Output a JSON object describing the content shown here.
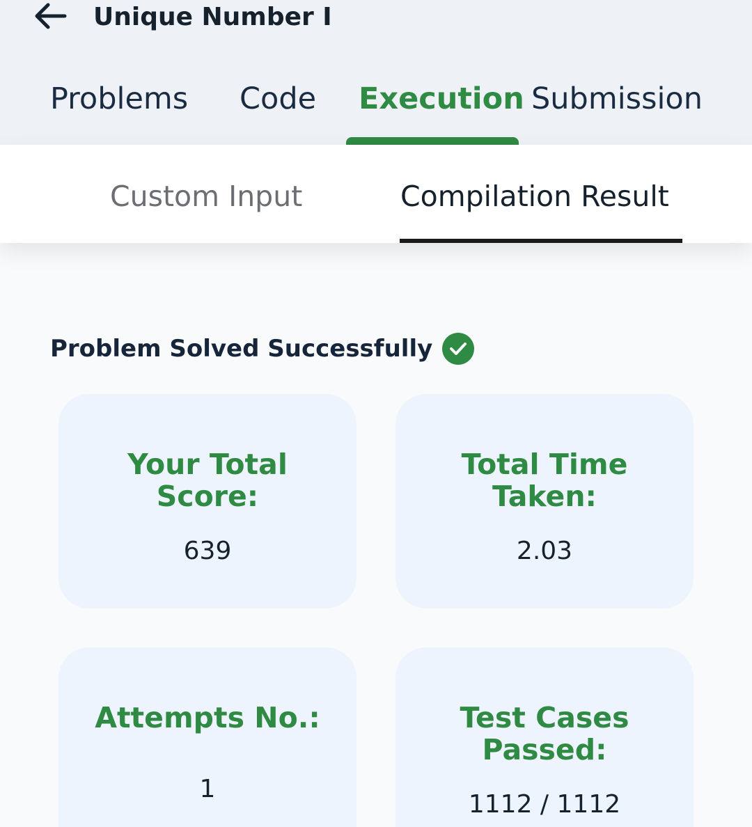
{
  "header": {
    "back_icon": "arrow-left-icon",
    "title": "Unique Number I"
  },
  "tabs": [
    {
      "label": "Problems",
      "active": false
    },
    {
      "label": "Code",
      "active": false
    },
    {
      "label": "Execution",
      "active": true
    },
    {
      "label": "Submission",
      "active": false
    }
  ],
  "subtabs": [
    {
      "label": "Custom Input",
      "active": false
    },
    {
      "label": "Compilation Result",
      "active": true
    }
  ],
  "status": {
    "text": "Problem Solved Successfully",
    "icon": "check-circle-icon"
  },
  "cards": [
    {
      "label": "Your Total\nScore:",
      "value": "639"
    },
    {
      "label": "Total Time\nTaken:",
      "value": "2.03"
    },
    {
      "label": "Attempts No.:",
      "value": "1"
    },
    {
      "label": "Test Cases\nPassed:",
      "value": "1112 / 1112"
    }
  ],
  "colors": {
    "accent": "#2f8a43",
    "header_bg": "#eef2f6",
    "card_bg": "#eef4fd",
    "text_dark": "#16212e"
  }
}
